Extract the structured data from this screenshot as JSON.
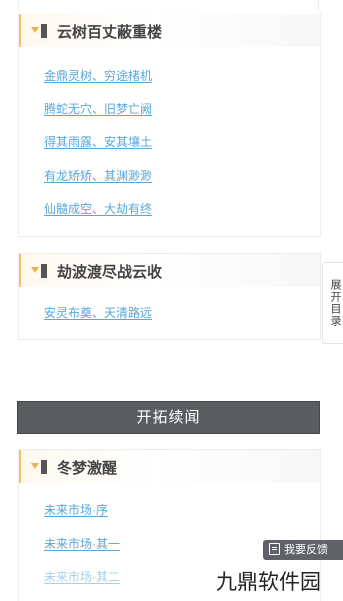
{
  "sections": [
    {
      "title": "云树百丈蔽重楼",
      "items": [
        "金鼎灵树、穷途楮机",
        "腾蛇无穴、旧梦亡阙",
        "得其雨露、安其壤土",
        "有龙矫矫、其渊渺渺",
        "仙髓成空、大劫有终"
      ]
    },
    {
      "title": "劫波渡尽战云收",
      "items": [
        "安灵布奠、天清路远"
      ]
    },
    {
      "title": "冬梦激醒",
      "items": [
        "未来市场·序",
        "未来市场·其一",
        "未来市场·其二"
      ]
    }
  ],
  "continue_button": "开拓续闻",
  "toc_tab": "展开目录",
  "feedback_button": "我要反馈",
  "brand_watermark": "九鼎软件园",
  "colors": {
    "link": "#5aa6d8",
    "accent": "#f3c36a",
    "button_bg": "#5a5d62"
  }
}
